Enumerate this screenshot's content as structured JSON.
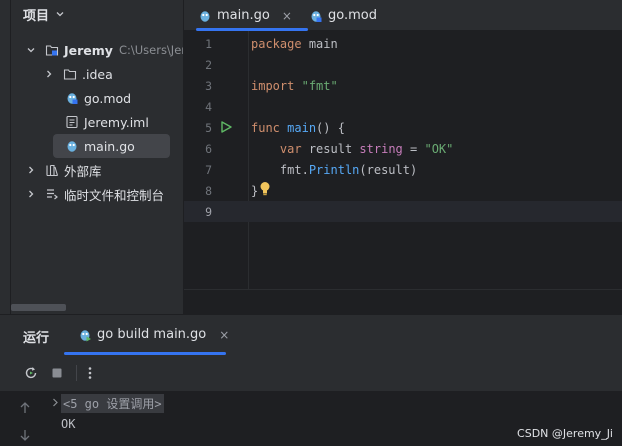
{
  "project_panel": {
    "title": "项目",
    "tree": [
      {
        "label": "Jeremy",
        "path": "C:\\Users\\Jer"
      },
      {
        "label": ".idea"
      },
      {
        "label": "go.mod"
      },
      {
        "label": "Jeremy.iml"
      },
      {
        "label": "main.go"
      },
      {
        "label": "外部库"
      },
      {
        "label": "临时文件和控制台"
      }
    ]
  },
  "editor": {
    "tabs": [
      {
        "label": "main.go",
        "active": true
      },
      {
        "label": "go.mod",
        "active": false
      }
    ],
    "close_glyph": "×",
    "line_numbers": [
      "1",
      "2",
      "3",
      "4",
      "5",
      "6",
      "7",
      "8",
      "9"
    ],
    "current_line": "9",
    "lines": {
      "l1": {
        "kw": "package",
        "name": "main"
      },
      "l3": {
        "kw": "import",
        "str": "\"fmt\""
      },
      "l5": {
        "kw": "func",
        "fn": "main",
        "rest": "() {"
      },
      "l6": {
        "kw": "var",
        "name": "result",
        "type": "string",
        "eq": "=",
        "str": "\"OK\""
      },
      "l7": {
        "pkg": "fmt",
        "fn": "Println",
        "rest": "(result)"
      },
      "l8": {
        "text": "}"
      }
    }
  },
  "run_panel": {
    "title": "运行",
    "tab_label": "go build main.go",
    "command": "<5 go 设置调用>",
    "output": "OK"
  },
  "watermark": "CSDN @Jeremy_Ji",
  "colors": {
    "accent": "#3574f0",
    "keyword": "#cf8e6d",
    "function": "#56a8f5",
    "string": "#6aab73",
    "type": "#c77dbb",
    "run_green": "#5fb865"
  }
}
